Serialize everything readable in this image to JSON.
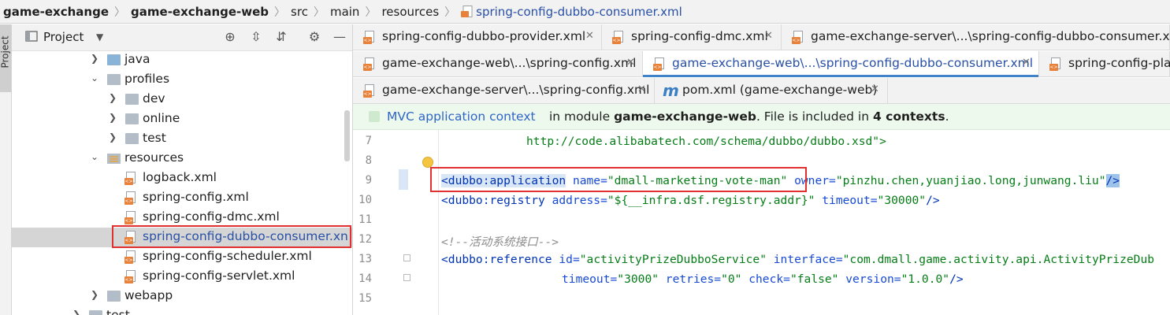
{
  "breadcrumb": {
    "items": [
      "game-exchange",
      "game-exchange-web",
      "src",
      "main",
      "resources",
      "spring-config-dubbo-consumer.xml"
    ]
  },
  "side_stripe": {
    "label": "Project"
  },
  "project_panel": {
    "title": "Project",
    "tree": [
      {
        "label": "java",
        "state": "collapsed",
        "icon": "folder-blue-icon"
      },
      {
        "label": "profiles",
        "state": "expanded",
        "icon": "folder-icon"
      },
      {
        "label": "dev",
        "state": "collapsed",
        "icon": "folder-icon"
      },
      {
        "label": "online",
        "state": "collapsed",
        "icon": "folder-icon"
      },
      {
        "label": "test",
        "state": "collapsed",
        "icon": "folder-icon"
      },
      {
        "label": "resources",
        "state": "expanded",
        "icon": "resources-folder-icon"
      },
      {
        "label": "logback.xml",
        "icon": "xml-file-icon"
      },
      {
        "label": "spring-config.xml",
        "icon": "xml-file-icon"
      },
      {
        "label": "spring-config-dmc.xml",
        "icon": "xml-file-icon"
      },
      {
        "label": "spring-config-dubbo-consumer.xn",
        "icon": "xml-file-icon",
        "selected": true
      },
      {
        "label": "spring-config-scheduler.xml",
        "icon": "xml-file-icon"
      },
      {
        "label": "spring-config-servlet.xml",
        "icon": "xml-file-icon"
      },
      {
        "label": "webapp",
        "state": "collapsed",
        "icon": "folder-icon"
      },
      {
        "label": "test",
        "state": "collapsed",
        "icon": "folder-icon"
      }
    ]
  },
  "tabs": {
    "row1": [
      "spring-config-dubbo-provider.xml",
      "spring-config-dmc.xml",
      "game-exchange-server\\...\\spring-config-dubbo-consumer.xml"
    ],
    "row2": [
      "game-exchange-web\\...\\spring-config.xml",
      "game-exchange-web\\...\\spring-config-dubbo-consumer.xml",
      "spring-config-plac"
    ],
    "row3": [
      "game-exchange-server\\...\\spring-config.xml",
      "pom.xml (game-exchange-web)"
    ],
    "active": "game-exchange-web\\...\\spring-config-dubbo-consumer.xml"
  },
  "banner": {
    "link": "MVC application context",
    "prefix": "in module ",
    "module": "game-exchange-web",
    "middle": ". File is included in ",
    "contexts": "4 contexts",
    "suffix": "."
  },
  "editor": {
    "line_numbers": [
      "7",
      "8",
      "9",
      "10",
      "11",
      "12",
      "13",
      "14",
      "15"
    ],
    "lines": {
      "l7_val": "http://code.alibabatech.com/schema/dubbo/dubbo.xsd\">",
      "l9_tag": "<dubbo:application",
      "l9_attr1": " name=",
      "l9_val1": "\"dmall-marketing-vote-man\"",
      "l9_attr2": " owner=",
      "l9_val2": "\"pinzhu.chen,yuanjiao.long,junwang.liu\"",
      "l9_end": "/>",
      "l10_tag": "<dubbo:registry",
      "l10_attr1": " address=",
      "l10_val1": "\"${__infra.dsf.registry.addr}\"",
      "l10_attr2": " timeout=",
      "l10_val2": "\"30000\"",
      "l10_end": "/>",
      "l12_comment": "<!--活动系统接口-->",
      "l13_tag": "<dubbo:reference",
      "l13_attr1": " id=",
      "l13_val1": "\"activityPrizeDubboService\"",
      "l13_attr2": " interface=",
      "l13_val2": "\"com.dmall.game.activity.api.ActivityPrizeDub",
      "l14_attr1": "timeout=",
      "l14_val1": "\"3000\"",
      "l14_attr2": " retries=",
      "l14_val2": "\"0\"",
      "l14_attr3": " check=",
      "l14_val3": "\"false\"",
      "l14_attr4": " version=",
      "l14_val4": "\"1.0.0\"",
      "l14_end": "/>"
    }
  },
  "colors": {
    "tag": "#0033b3",
    "value": "#067d17",
    "comment": "#8c8c8c",
    "highlight_box": "#e03030",
    "active_tab_underline": "#4083c9",
    "banner_bg": "#eef9ee"
  }
}
